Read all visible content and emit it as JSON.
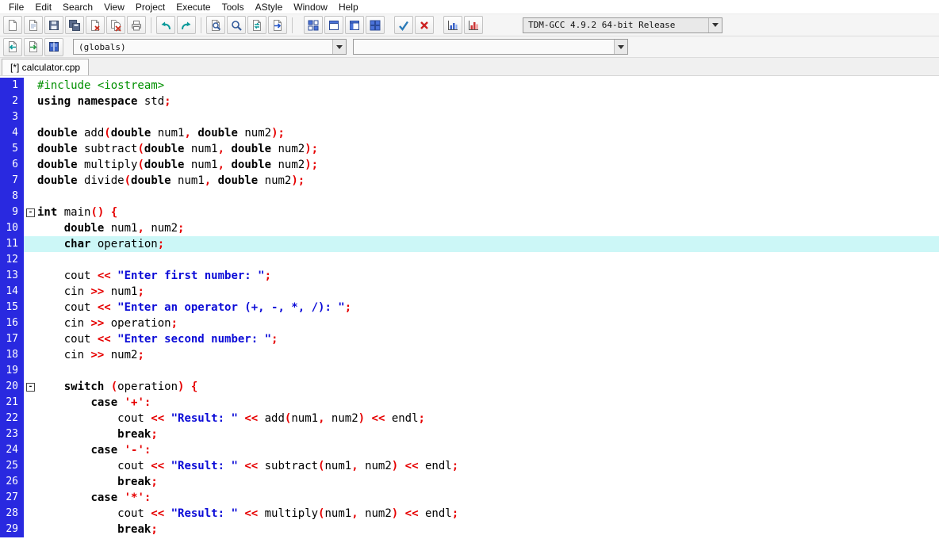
{
  "menu": {
    "items": [
      "File",
      "Edit",
      "Search",
      "View",
      "Project",
      "Execute",
      "Tools",
      "AStyle",
      "Window",
      "Help"
    ]
  },
  "toolbar_main": {
    "groups": [
      [
        "new-file",
        "open-file",
        "save",
        "save-all",
        "close",
        "close-all",
        "print"
      ],
      [
        "undo",
        "redo"
      ],
      [
        "find",
        "find-in-files",
        "replace",
        "goto-line"
      ],
      [
        "project-view",
        "window",
        "split-view",
        "tile-windows"
      ],
      [
        "syntax-check",
        "abort-compile"
      ],
      [
        "profile",
        "profile-delete"
      ]
    ],
    "compiler": "TDM-GCC 4.9.2 64-bit Release"
  },
  "toolbar_nav": {
    "buttons": [
      "goto-declaration",
      "goto-definition",
      "class-browser"
    ],
    "globals": "(globals)",
    "members": ""
  },
  "tab": {
    "label": "[*] calculator.cpp"
  },
  "colors": {
    "gutter_bg": "#2929e0",
    "current_line_bg": "#ccf7f7",
    "keyword": "#000000",
    "string": "#0b0bd7",
    "operator": "#e60000",
    "preprocessor": "#009000"
  },
  "editor": {
    "current_line": 11,
    "fold_lines": [
      9,
      20
    ],
    "lines": [
      {
        "n": 1,
        "t": [
          [
            "p",
            "#include <iostream>"
          ]
        ]
      },
      {
        "n": 2,
        "t": [
          [
            "k",
            "using"
          ],
          [
            "n",
            " "
          ],
          [
            "k",
            "namespace"
          ],
          [
            "n",
            " std"
          ],
          [
            "o",
            ";"
          ]
        ]
      },
      {
        "n": 3,
        "t": []
      },
      {
        "n": 4,
        "t": [
          [
            "k",
            "double"
          ],
          [
            "n",
            " add"
          ],
          [
            "o",
            "("
          ],
          [
            "k",
            "double"
          ],
          [
            "n",
            " num1"
          ],
          [
            "o",
            ","
          ],
          [
            "n",
            " "
          ],
          [
            "k",
            "double"
          ],
          [
            "n",
            " num2"
          ],
          [
            "o",
            ");"
          ]
        ]
      },
      {
        "n": 5,
        "t": [
          [
            "k",
            "double"
          ],
          [
            "n",
            " subtract"
          ],
          [
            "o",
            "("
          ],
          [
            "k",
            "double"
          ],
          [
            "n",
            " num1"
          ],
          [
            "o",
            ","
          ],
          [
            "n",
            " "
          ],
          [
            "k",
            "double"
          ],
          [
            "n",
            " num2"
          ],
          [
            "o",
            ");"
          ]
        ]
      },
      {
        "n": 6,
        "t": [
          [
            "k",
            "double"
          ],
          [
            "n",
            " multiply"
          ],
          [
            "o",
            "("
          ],
          [
            "k",
            "double"
          ],
          [
            "n",
            " num1"
          ],
          [
            "o",
            ","
          ],
          [
            "n",
            " "
          ],
          [
            "k",
            "double"
          ],
          [
            "n",
            " num2"
          ],
          [
            "o",
            ");"
          ]
        ]
      },
      {
        "n": 7,
        "t": [
          [
            "k",
            "double"
          ],
          [
            "n",
            " divide"
          ],
          [
            "o",
            "("
          ],
          [
            "k",
            "double"
          ],
          [
            "n",
            " num1"
          ],
          [
            "o",
            ","
          ],
          [
            "n",
            " "
          ],
          [
            "k",
            "double"
          ],
          [
            "n",
            " num2"
          ],
          [
            "o",
            ");"
          ]
        ]
      },
      {
        "n": 8,
        "t": []
      },
      {
        "n": 9,
        "t": [
          [
            "k",
            "int"
          ],
          [
            "n",
            " main"
          ],
          [
            "o",
            "()"
          ],
          [
            "n",
            " "
          ],
          [
            "o",
            "{"
          ]
        ]
      },
      {
        "n": 10,
        "t": [
          [
            "n",
            "    "
          ],
          [
            "k",
            "double"
          ],
          [
            "n",
            " num1"
          ],
          [
            "o",
            ","
          ],
          [
            "n",
            " num2"
          ],
          [
            "o",
            ";"
          ]
        ]
      },
      {
        "n": 11,
        "t": [
          [
            "n",
            "    "
          ],
          [
            "k",
            "char"
          ],
          [
            "n",
            " operation"
          ],
          [
            "o",
            ";"
          ]
        ]
      },
      {
        "n": 12,
        "t": []
      },
      {
        "n": 13,
        "t": [
          [
            "n",
            "    cout "
          ],
          [
            "o",
            "<<"
          ],
          [
            "n",
            " "
          ],
          [
            "s",
            "\"Enter first number: \""
          ],
          [
            "o",
            ";"
          ]
        ]
      },
      {
        "n": 14,
        "t": [
          [
            "n",
            "    cin "
          ],
          [
            "o",
            ">>"
          ],
          [
            "n",
            " num1"
          ],
          [
            "o",
            ";"
          ]
        ]
      },
      {
        "n": 15,
        "t": [
          [
            "n",
            "    cout "
          ],
          [
            "o",
            "<<"
          ],
          [
            "n",
            " "
          ],
          [
            "s",
            "\"Enter an operator (+, -, *, /): \""
          ],
          [
            "o",
            ";"
          ]
        ]
      },
      {
        "n": 16,
        "t": [
          [
            "n",
            "    cin "
          ],
          [
            "o",
            ">>"
          ],
          [
            "n",
            " operation"
          ],
          [
            "o",
            ";"
          ]
        ]
      },
      {
        "n": 17,
        "t": [
          [
            "n",
            "    cout "
          ],
          [
            "o",
            "<<"
          ],
          [
            "n",
            " "
          ],
          [
            "s",
            "\"Enter second number: \""
          ],
          [
            "o",
            ";"
          ]
        ]
      },
      {
        "n": 18,
        "t": [
          [
            "n",
            "    cin "
          ],
          [
            "o",
            ">>"
          ],
          [
            "n",
            " num2"
          ],
          [
            "o",
            ";"
          ]
        ]
      },
      {
        "n": 19,
        "t": []
      },
      {
        "n": 20,
        "t": [
          [
            "n",
            "    "
          ],
          [
            "k",
            "switch"
          ],
          [
            "n",
            " "
          ],
          [
            "o",
            "("
          ],
          [
            "n",
            "operation"
          ],
          [
            "o",
            ")"
          ],
          [
            "n",
            " "
          ],
          [
            "o",
            "{"
          ]
        ]
      },
      {
        "n": 21,
        "t": [
          [
            "n",
            "        "
          ],
          [
            "k",
            "case"
          ],
          [
            "n",
            " "
          ],
          [
            "o",
            "'+':"
          ]
        ]
      },
      {
        "n": 22,
        "t": [
          [
            "n",
            "            cout "
          ],
          [
            "o",
            "<<"
          ],
          [
            "n",
            " "
          ],
          [
            "s",
            "\"Result: \""
          ],
          [
            "n",
            " "
          ],
          [
            "o",
            "<<"
          ],
          [
            "n",
            " add"
          ],
          [
            "o",
            "("
          ],
          [
            "n",
            "num1"
          ],
          [
            "o",
            ","
          ],
          [
            "n",
            " num2"
          ],
          [
            "o",
            ")"
          ],
          [
            "n",
            " "
          ],
          [
            "o",
            "<<"
          ],
          [
            "n",
            " endl"
          ],
          [
            "o",
            ";"
          ]
        ]
      },
      {
        "n": 23,
        "t": [
          [
            "n",
            "            "
          ],
          [
            "k",
            "break"
          ],
          [
            "o",
            ";"
          ]
        ]
      },
      {
        "n": 24,
        "t": [
          [
            "n",
            "        "
          ],
          [
            "k",
            "case"
          ],
          [
            "n",
            " "
          ],
          [
            "o",
            "'-':"
          ]
        ]
      },
      {
        "n": 25,
        "t": [
          [
            "n",
            "            cout "
          ],
          [
            "o",
            "<<"
          ],
          [
            "n",
            " "
          ],
          [
            "s",
            "\"Result: \""
          ],
          [
            "n",
            " "
          ],
          [
            "o",
            "<<"
          ],
          [
            "n",
            " subtract"
          ],
          [
            "o",
            "("
          ],
          [
            "n",
            "num1"
          ],
          [
            "o",
            ","
          ],
          [
            "n",
            " num2"
          ],
          [
            "o",
            ")"
          ],
          [
            "n",
            " "
          ],
          [
            "o",
            "<<"
          ],
          [
            "n",
            " endl"
          ],
          [
            "o",
            ";"
          ]
        ]
      },
      {
        "n": 26,
        "t": [
          [
            "n",
            "            "
          ],
          [
            "k",
            "break"
          ],
          [
            "o",
            ";"
          ]
        ]
      },
      {
        "n": 27,
        "t": [
          [
            "n",
            "        "
          ],
          [
            "k",
            "case"
          ],
          [
            "n",
            " "
          ],
          [
            "o",
            "'*':"
          ]
        ]
      },
      {
        "n": 28,
        "t": [
          [
            "n",
            "            cout "
          ],
          [
            "o",
            "<<"
          ],
          [
            "n",
            " "
          ],
          [
            "s",
            "\"Result: \""
          ],
          [
            "n",
            " "
          ],
          [
            "o",
            "<<"
          ],
          [
            "n",
            " multiply"
          ],
          [
            "o",
            "("
          ],
          [
            "n",
            "num1"
          ],
          [
            "o",
            ","
          ],
          [
            "n",
            " num2"
          ],
          [
            "o",
            ")"
          ],
          [
            "n",
            " "
          ],
          [
            "o",
            "<<"
          ],
          [
            "n",
            " endl"
          ],
          [
            "o",
            ";"
          ]
        ]
      },
      {
        "n": 29,
        "t": [
          [
            "n",
            "            "
          ],
          [
            "k",
            "break"
          ],
          [
            "o",
            ";"
          ]
        ]
      }
    ]
  }
}
